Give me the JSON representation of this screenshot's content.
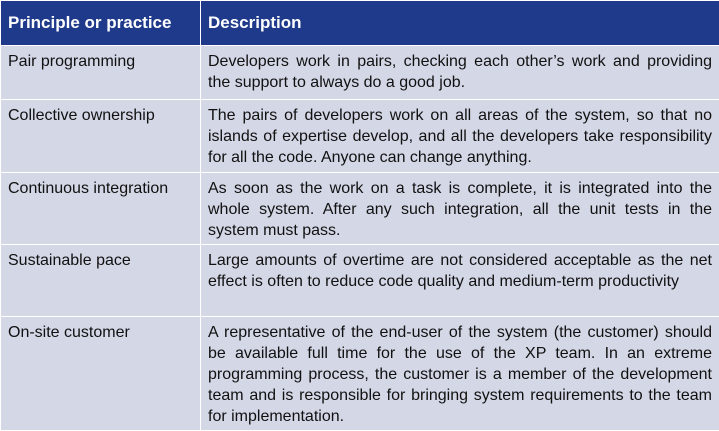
{
  "colors": {
    "header_bg": "#1f3a8a",
    "header_text": "#ffffff",
    "row_bg": "#d3d7e6",
    "body_text": "#111111"
  },
  "table": {
    "headers": [
      "Principle or practice",
      "Description"
    ],
    "rows": [
      {
        "principle": "Pair programming",
        "description": "Developers work in pairs, checking each other’s work and providing the support to always do a good job."
      },
      {
        "principle": "Collective ownership",
        "description": "The pairs of developers work on all areas of the system, so that no islands of expertise develop, and all the developers take responsibility for all the code. Anyone can change anything."
      },
      {
        "principle": "Continuous integration",
        "description": "As soon as the work on a task is complete, it is integrated into the whole system. After any such integration, all the unit tests in the system must pass."
      },
      {
        "principle": "Sustainable pace",
        "description": "Large amounts of overtime are not considered acceptable as the net effect is often to reduce code quality and medium-term productivity"
      },
      {
        "principle": "On-site customer",
        "description": "A representative of the end-user of the system (the customer) should be available full time for the use of the XP team. In an extreme programming process, the customer is a member of the development team and is responsible for bringing system requirements to the team for implementation."
      }
    ]
  }
}
